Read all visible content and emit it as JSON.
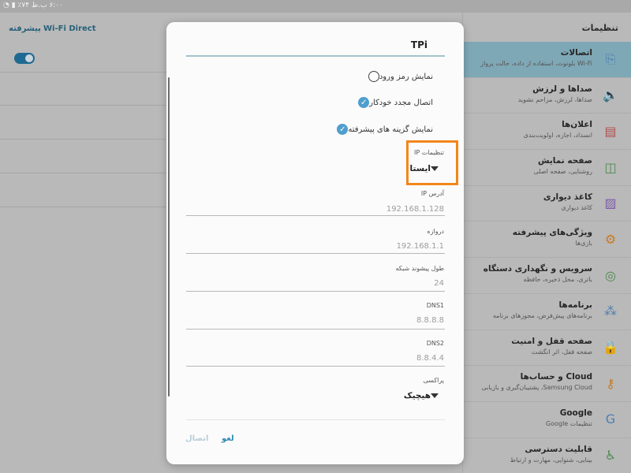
{
  "status_bar": {
    "text": "۶:۰۰ ب.ظ ۷۴٪ ▮ ◔"
  },
  "left_pane": {
    "advanced_label": "پیشرفته",
    "wifi_direct_label": "Wi-Fi Direct",
    "toggle_on": true
  },
  "right_pane": {
    "title": "تنظیمات",
    "items": [
      {
        "icon": "connections-icon",
        "title": "اتصالات",
        "subtitle": "Wi-Fi بلوتوث، استفاده از داده، حالت پرواز",
        "active": true
      },
      {
        "icon": "sound-icon",
        "title": "صداها و لرزش",
        "subtitle": "صداها، لرزش، مزاحم نشوید"
      },
      {
        "icon": "notifications-icon",
        "title": "اعلان‌ها",
        "subtitle": "انسداد، اجازه، اولویت‌بندی"
      },
      {
        "icon": "display-icon",
        "title": "صفحه نمایش",
        "subtitle": "روشنایی، صفحه اصلی"
      },
      {
        "icon": "wallpaper-icon",
        "title": "کاغذ دیواری",
        "subtitle": "کاغذ دیواری"
      },
      {
        "icon": "advanced-features-icon",
        "title": "ویژگی‌های پیشرفته",
        "subtitle": "بازی‌ها"
      },
      {
        "icon": "device-maintenance-icon",
        "title": "سرویس و نگهداری دستگاه",
        "subtitle": "باتری، محل ذخیره، حافظه"
      },
      {
        "icon": "apps-icon",
        "title": "برنامه‌ها",
        "subtitle": "برنامه‌های پیش‌فرض، مجوزهای برنامه"
      },
      {
        "icon": "lock-icon",
        "title": "صفحه قفل و امنیت",
        "subtitle": "صفحه قفل، اثر انگشت"
      },
      {
        "icon": "cloud-accounts-icon",
        "title": "Cloud و حساب‌ها",
        "subtitle": "Samsung Cloud، پشتیبان‌گیری و بازیابی"
      },
      {
        "icon": "google-icon",
        "title": "Google",
        "subtitle": "تنظیمات Google"
      },
      {
        "icon": "accessibility-icon",
        "title": "قابلیت دسترسی",
        "subtitle": "بینایی، شنوایی، مهارت و ارتباط"
      }
    ]
  },
  "dialog": {
    "title": "TPi",
    "checkboxes": [
      {
        "label": "نمایش رمز ورود",
        "checked": false
      },
      {
        "label": "اتصال مجدد خودکار",
        "checked": true
      },
      {
        "label": "نمایش گزینه های پیشرفته",
        "checked": true
      }
    ],
    "ip_settings": {
      "label": "تنظیمات IP",
      "value": "ایستا"
    },
    "fields": [
      {
        "label": "آدرس IP",
        "placeholder": "192.168.1.128"
      },
      {
        "label": "دروازه",
        "placeholder": "192.168.1.1"
      },
      {
        "label": "طول پیشوند شبکه",
        "placeholder": "24"
      },
      {
        "label": "DNS1",
        "placeholder": "8.8.8.8"
      },
      {
        "label": "DNS2",
        "placeholder": "8.8.4.4"
      }
    ],
    "proxy": {
      "label": "پراکسی",
      "value": "هیچیک"
    },
    "cancel_label": "لغو",
    "connect_label": "اتصال"
  },
  "colors": {
    "highlight_box": "#f3861b",
    "accent": "#4e9fcf",
    "link": "#2e89b4"
  }
}
